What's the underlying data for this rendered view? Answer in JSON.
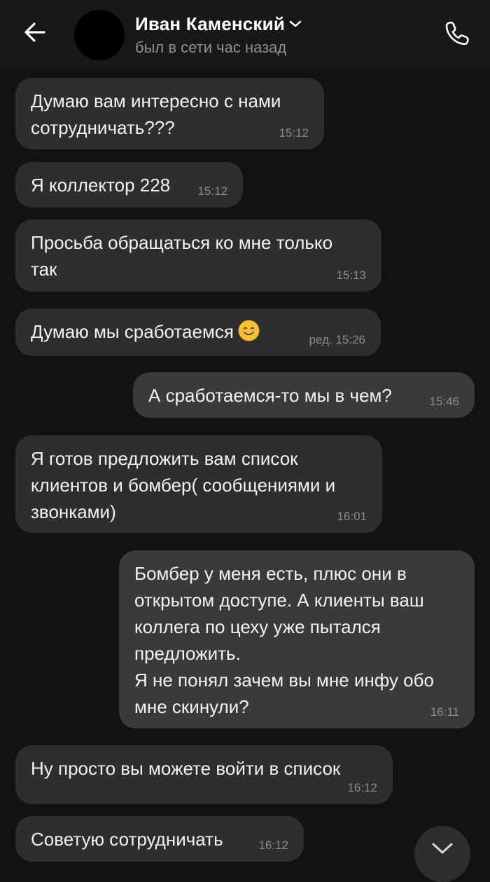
{
  "header": {
    "contact_name": "Иван Каменский",
    "status": "был в сети час назад",
    "icons": {
      "back": "arrow-left-icon",
      "chevron": "chevron-down-icon",
      "call": "phone-icon"
    }
  },
  "messages": [
    {
      "direction": "incoming",
      "text": "Думаю вам интересно с нами\nсотрудничать???",
      "time": "15:12"
    },
    {
      "direction": "incoming",
      "text": "Я коллектор 228",
      "time": "15:12"
    },
    {
      "direction": "incoming",
      "text": "Просьба обращаться ко мне только\nтак",
      "time": "15:13"
    },
    {
      "direction": "incoming",
      "text": "Думаю мы сработаемся",
      "emoji": "smiling-face-emoji",
      "time": "ред. 15:26"
    },
    {
      "direction": "outgoing",
      "text": "А сработаемся-то мы в чем?",
      "time": "15:46"
    },
    {
      "direction": "incoming",
      "text": "Я готов предложить вам список\nклиентов и бомбер( сообщениями и\nзвонками)",
      "time": "16:01"
    },
    {
      "direction": "outgoing",
      "text": "Бомбер у меня есть, плюс они в\nоткрытом доступе. А клиенты ваш\nколлега по цеху уже пытался\nпредложить.\nЯ не понял зачем вы мне инфу обо\nмне скинули?",
      "time": "16:11"
    },
    {
      "direction": "incoming",
      "text": "Ну просто вы можете войти в список",
      "time": "16:12"
    },
    {
      "direction": "incoming",
      "text": "Советую сотрудничать",
      "time": "16:12"
    }
  ],
  "scroll_button": {
    "icon": "chevron-down-icon"
  }
}
